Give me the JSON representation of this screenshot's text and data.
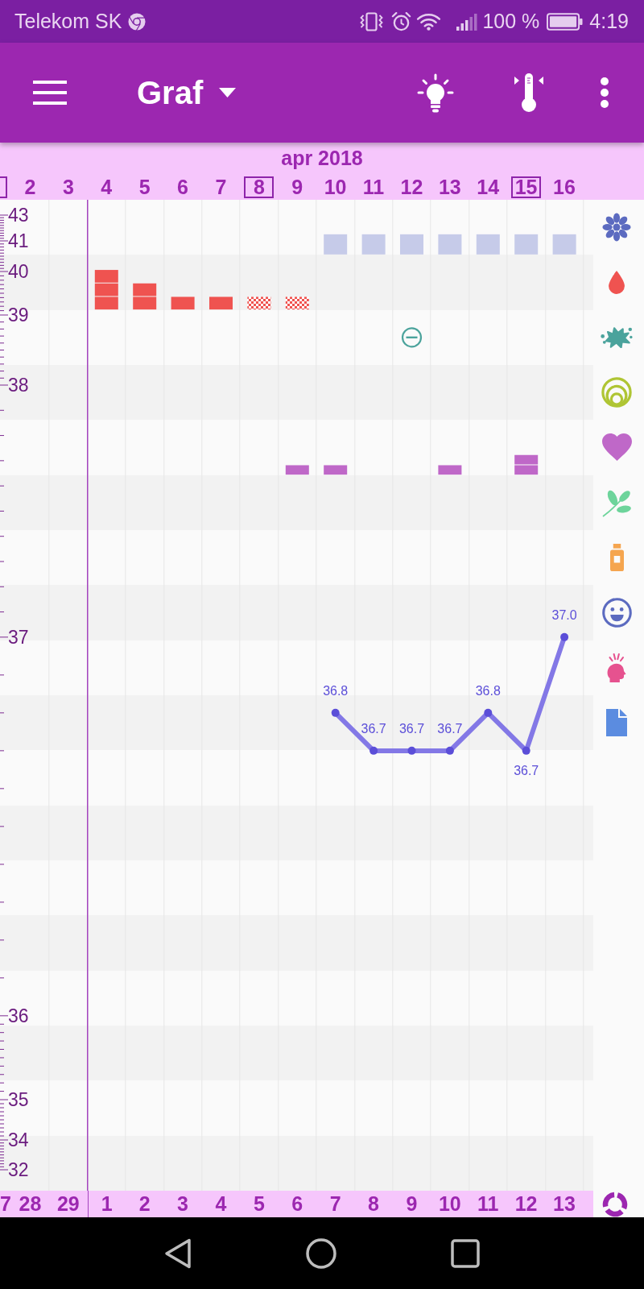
{
  "status_bar": {
    "carrier": "Telekom SK",
    "battery": "100 %",
    "time": "4:19"
  },
  "app_bar": {
    "title": "Graf"
  },
  "date_header": {
    "month": "apr 2018",
    "edge_framed": true
  },
  "chart": {
    "legend": [
      {
        "kind": "flower",
        "color": "#5c6bc0"
      },
      {
        "kind": "drop",
        "color": "#ef5350"
      },
      {
        "kind": "splat",
        "color": "#4ba39c"
      },
      {
        "kind": "rings",
        "color": "#afc534"
      },
      {
        "kind": "heart",
        "color": "#bf68c8"
      },
      {
        "kind": "leaf",
        "color": "#6dd49b"
      },
      {
        "kind": "bottle",
        "color": "#f5a54f"
      },
      {
        "kind": "smiley",
        "color": "#5c6bc0"
      },
      {
        "kind": "person",
        "color": "#e6528f"
      },
      {
        "kind": "document",
        "color": "#5b8ce0"
      }
    ],
    "outer_scale_labels": [
      {
        "label": "43"
      },
      {
        "label": "41"
      },
      {
        "label": "40"
      },
      {
        "label": "39"
      },
      {
        "label": "38"
      },
      {
        "label": "35"
      },
      {
        "label": "34"
      },
      {
        "label": "32"
      }
    ],
    "columns": [
      {
        "framed": false
      },
      {
        "framed": false
      },
      {
        "framed": false,
        "symptoms": [
          {
            "kind": "drop",
            "marks": [
              {
                "kind": "block"
              },
              {
                "kind": "block"
              },
              {
                "kind": "block"
              }
            ]
          }
        ]
      },
      {
        "framed": false,
        "symptoms": [
          {
            "kind": "drop",
            "marks": [
              {
                "kind": "block"
              },
              {
                "kind": "block"
              }
            ]
          }
        ]
      },
      {
        "framed": false,
        "symptoms": [
          {
            "kind": "drop",
            "marks": [
              {
                "kind": "block"
              }
            ]
          }
        ]
      },
      {
        "framed": false,
        "symptoms": [
          {
            "kind": "drop",
            "marks": [
              {
                "kind": "block"
              }
            ]
          }
        ]
      },
      {
        "framed": true,
        "symptoms": [
          {
            "kind": "drop",
            "marks": [
              {
                "kind": "checkered"
              }
            ]
          }
        ]
      },
      {
        "framed": false,
        "symptoms": [
          {
            "kind": "drop",
            "marks": [
              {
                "kind": "checkered"
              }
            ]
          },
          {
            "kind": "heart",
            "marks": [
              {
                "kind": "dash"
              }
            ]
          }
        ]
      },
      {
        "framed": false,
        "symptoms": [
          {
            "kind": "flower",
            "marks": [
              {
                "kind": "square"
              }
            ]
          },
          {
            "kind": "heart",
            "marks": [
              {
                "kind": "dash"
              }
            ]
          }
        ]
      },
      {
        "framed": false,
        "symptoms": [
          {
            "kind": "flower",
            "marks": [
              {
                "kind": "square"
              }
            ]
          }
        ]
      },
      {
        "framed": false,
        "symptoms": [
          {
            "kind": "flower",
            "marks": [
              {
                "kind": "square"
              }
            ]
          },
          {
            "kind": "splat",
            "marks": [
              {
                "kind": "minus"
              }
            ]
          }
        ]
      },
      {
        "framed": false,
        "symptoms": [
          {
            "kind": "flower",
            "marks": [
              {
                "kind": "square"
              }
            ]
          },
          {
            "kind": "heart",
            "marks": [
              {
                "kind": "dash"
              }
            ]
          }
        ]
      },
      {
        "framed": false,
        "symptoms": [
          {
            "kind": "flower",
            "marks": [
              {
                "kind": "square"
              }
            ]
          }
        ]
      },
      {
        "framed": true,
        "symptoms": [
          {
            "kind": "flower",
            "marks": [
              {
                "kind": "square"
              }
            ]
          },
          {
            "kind": "heart",
            "marks": [
              {
                "kind": "dash"
              },
              {
                "kind": "dash"
              }
            ]
          }
        ]
      },
      {
        "framed": false,
        "symptoms": [
          {
            "kind": "flower",
            "marks": [
              {
                "kind": "square"
              }
            ]
          }
        ]
      }
    ],
    "chart_data": {
      "type": "line",
      "categories": [
        "2",
        "3",
        "4",
        "5",
        "6",
        "7",
        "8",
        "9",
        "10",
        "11",
        "12",
        "13",
        "14",
        "15",
        "16"
      ],
      "ylim": [
        35.538,
        38.155
      ],
      "yticks": [
        36,
        37
      ],
      "series": [
        {
          "color": "#8378e6",
          "marker": "circle",
          "values": [
            null,
            null,
            null,
            null,
            null,
            null,
            null,
            null,
            36.8,
            36.7,
            36.7,
            36.7,
            36.8,
            36.7,
            37.0
          ]
        }
      ],
      "value_labels": [
        null,
        null,
        null,
        null,
        null,
        null,
        null,
        null,
        "36.8",
        "36.7",
        "36.7",
        "36.7",
        "36.8",
        "36.7",
        "37.0"
      ]
    }
  },
  "cycle_days": {
    "edge_label": "7",
    "days": [
      {
        "label": "28",
        "cycle_start": false
      },
      {
        "label": "29",
        "cycle_start": false
      },
      {
        "label": "1",
        "cycle_start": true
      },
      {
        "label": "2",
        "cycle_start": false
      },
      {
        "label": "3",
        "cycle_start": false
      },
      {
        "label": "4",
        "cycle_start": false
      },
      {
        "label": "5",
        "cycle_start": false
      },
      {
        "label": "6",
        "cycle_start": false
      },
      {
        "label": "7",
        "cycle_start": false
      },
      {
        "label": "8",
        "cycle_start": false
      },
      {
        "label": "9",
        "cycle_start": false
      },
      {
        "label": "10",
        "cycle_start": false
      },
      {
        "label": "11",
        "cycle_start": false
      },
      {
        "label": "12",
        "cycle_start": false
      },
      {
        "label": "13",
        "cycle_start": false
      }
    ]
  }
}
